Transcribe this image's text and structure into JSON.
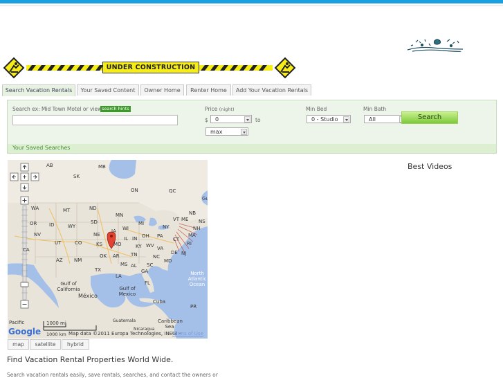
{
  "banner": {
    "label": "UNDER CONSTRUCTION"
  },
  "tabs": [
    {
      "label": "Search Vacation Rentals"
    },
    {
      "label": "Your Saved Content"
    },
    {
      "label": "Owner Home"
    },
    {
      "label": "Renter Home"
    },
    {
      "label": "Add Your Vacation Rentals"
    }
  ],
  "search": {
    "prompt": "Search ex: Mid Town Motel or view",
    "hints_label": "search hints",
    "query_value": "",
    "price_label": "Price",
    "price_unit": "(night)",
    "currency": "$",
    "price_min": "0",
    "to_label": "to",
    "price_max": "max",
    "min_bed_label": "Min Bed",
    "min_bed_value": "0 - Studio",
    "min_bath_label": "Min Bath",
    "min_bath_value": "All",
    "button": "Search"
  },
  "saved_searches": {
    "label": "Your Saved Searches"
  },
  "map": {
    "labels": {
      "ab": "AB",
      "mb": "MB",
      "sk": "SK",
      "on": "ON",
      "qc": "QC",
      "wa": "WA",
      "mt": "MT",
      "nd": "ND",
      "or": "OR",
      "id": "ID",
      "wy": "WY",
      "sd": "SD",
      "mn": "MN",
      "wi": "WI",
      "mi": "MI",
      "ny": "NY",
      "vt": "VT",
      "me": "ME",
      "nb": "NB",
      "ns": "NS",
      "nh": "NH",
      "ma": "MA",
      "ct": "CT",
      "ri": "RI",
      "ca": "CA",
      "nv": "NV",
      "ut": "UT",
      "co": "CO",
      "ne": "NE",
      "ia": "IA",
      "ks": "KS",
      "mo": "MO",
      "il": "IL",
      "in": "IN",
      "oh": "OH",
      "pa": "PA",
      "nj": "NJ",
      "de": "DE",
      "md": "MD",
      "va": "VA",
      "wv": "WV",
      "ky": "KY",
      "tn": "TN",
      "nc": "NC",
      "sc": "SC",
      "ga": "GA",
      "al": "AL",
      "ms": "MS",
      "ar": "AR",
      "ok": "OK",
      "tx": "TX",
      "la": "LA",
      "fl": "FL",
      "az": "AZ",
      "nm": "NM",
      "north_atlantic": "North Atlantic Ocean",
      "gulf_california": "Gulf of California",
      "gulf_mexico": "Gulf of Mexico",
      "mexico": "México",
      "cuba": "Cuba",
      "caribbean": "Caribbean Sea",
      "guatemala": "Guatemala",
      "nicaragua": "Nicaragua",
      "pr": "PR",
      "pacific": "Pacific",
      "gu": "Gu"
    },
    "scale_top": "1000 mi",
    "scale_bottom": "1000 km",
    "attribution": "Map data ©2011 Europa Technologies, INEGI -",
    "terms": "Terms of Use",
    "google": "Google",
    "types": [
      "map",
      "satellite",
      "hybrid"
    ]
  },
  "best_videos": "Best Videos",
  "headline": "Find Vacation Rental Properties World Wide.",
  "subtext": "Search vacation rentals easily, save rentals, searches, and contact the owners or",
  "colors": {
    "accent": "#1a9fe0",
    "green": "#3d9a2a",
    "warning": "#f5ec18"
  }
}
